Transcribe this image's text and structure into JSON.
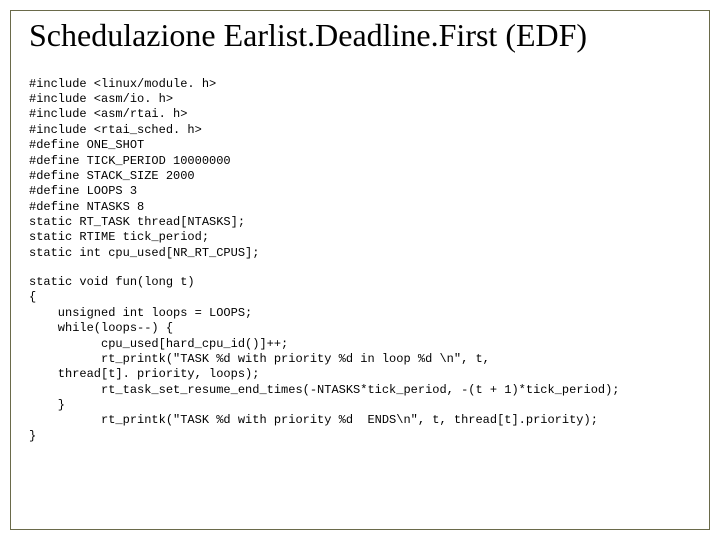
{
  "title": "Schedulazione Earlist.Deadline.First (EDF)",
  "code1": "#include <linux/module. h>\n#include <asm/io. h>\n#include <asm/rtai. h>\n#include <rtai_sched. h>\n#define ONE_SHOT\n#define TICK_PERIOD 10000000\n#define STACK_SIZE 2000\n#define LOOPS 3\n#define NTASKS 8\nstatic RT_TASK thread[NTASKS];\nstatic RTIME tick_period;\nstatic int cpu_used[NR_RT_CPUS];",
  "code2": "static void fun(long t)\n{\n    unsigned int loops = LOOPS;\n    while(loops--) {\n          cpu_used[hard_cpu_id()]++;\n          rt_printk(\"TASK %d with priority %d in loop %d \\n\", t,\n    thread[t]. priority, loops);\n          rt_task_set_resume_end_times(-NTASKS*tick_period, -(t + 1)*tick_period);\n    }\n          rt_printk(\"TASK %d with priority %d  ENDS\\n\", t, thread[t].priority);\n}"
}
